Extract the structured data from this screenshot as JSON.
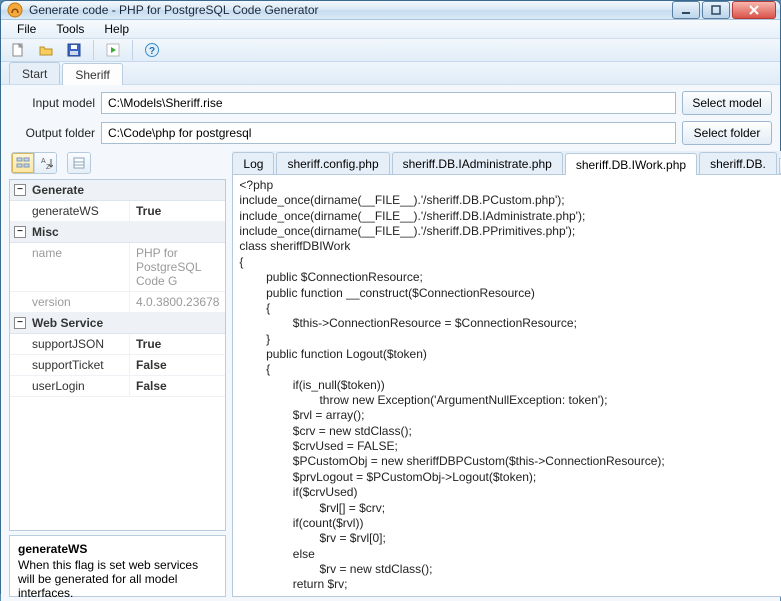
{
  "window": {
    "title": "Generate code - PHP for PostgreSQL Code Generator"
  },
  "menus": {
    "file": "File",
    "tools": "Tools",
    "help": "Help"
  },
  "main_tabs": {
    "start": "Start",
    "sheriff": "Sheriff"
  },
  "form": {
    "input_label": "Input model",
    "input_value": "C:\\Models\\Sheriff.rise",
    "output_label": "Output folder",
    "output_value": "C:\\Code\\php for postgresql",
    "select_model": "Select model",
    "select_folder": "Select folder"
  },
  "props": {
    "cat_generate": "Generate",
    "generateWS_k": "generateWS",
    "generateWS_v": "True",
    "cat_misc": "Misc",
    "name_k": "name",
    "name_v": "PHP for PostgreSQL Code G",
    "version_k": "version",
    "version_v": "4.0.3800.23678",
    "cat_ws": "Web Service",
    "supportJSON_k": "supportJSON",
    "supportJSON_v": "True",
    "supportTicket_k": "supportTicket",
    "supportTicket_v": "False",
    "userLogin_k": "userLogin",
    "userLogin_v": "False"
  },
  "desc": {
    "title": "generateWS",
    "body": "When this flag is set web services will be generated for all model interfaces."
  },
  "code_tabs": {
    "t1": "Log",
    "t2": "sheriff.config.php",
    "t3": "sheriff.DB.IAdministrate.php",
    "t4": "sheriff.DB.IWork.php",
    "t5": "sheriff.DB."
  },
  "code": "<?php\ninclude_once(dirname(__FILE__).'/sheriff.DB.PCustom.php');\ninclude_once(dirname(__FILE__).'/sheriff.DB.IAdministrate.php');\ninclude_once(dirname(__FILE__).'/sheriff.DB.PPrimitives.php');\nclass sheriffDBIWork\n{\n        public $ConnectionResource;\n        public function __construct($ConnectionResource)\n        {\n                $this->ConnectionResource = $ConnectionResource;\n        }\n        public function Logout($token)\n        {\n                if(is_null($token))\n                        throw new Exception('ArgumentNullException: token');\n                $rvl = array();\n                $crv = new stdClass();\n                $crvUsed = FALSE;\n                $PCustomObj = new sheriffDBPCustom($this->ConnectionResource);\n                $prvLogout = $PCustomObj->Logout($token);\n                if($crvUsed)\n                        $rvl[] = $crv;\n                if(count($rvl))\n                        $rv = $rvl[0];\n                else\n                        $rv = new stdClass();\n                return $rv;"
}
